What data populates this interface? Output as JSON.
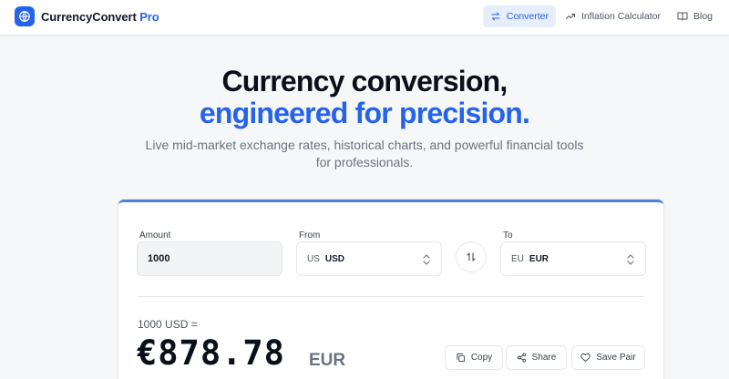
{
  "header": {
    "brand_name": "CurrencyConvert",
    "brand_suffix": "Pro",
    "nav": [
      {
        "label": "Converter",
        "icon": "swap-icon",
        "active": true
      },
      {
        "label": "Inflation Calculator",
        "icon": "trending-up-icon",
        "active": false
      },
      {
        "label": "Blog",
        "icon": "book-icon",
        "active": false
      }
    ]
  },
  "hero": {
    "title": "Currency conversion,",
    "title_accent": "engineered for precision.",
    "subtitle": "Live mid-market exchange rates, historical charts, and powerful financial tools for professionals."
  },
  "converter": {
    "amount_label": "Amount",
    "amount_value": "1000",
    "from_label": "From",
    "from_flag": "US",
    "from_code": "USD",
    "to_label": "To",
    "to_flag": "EU",
    "to_code": "EUR",
    "result_label": "1000 USD =",
    "result_value": "€878.78",
    "result_code": "EUR",
    "actions": {
      "copy": "Copy",
      "share": "Share",
      "save": "Save Pair"
    }
  },
  "colors": {
    "accent": "#2563eb",
    "background": "#f6f7f9",
    "card": "#ffffff"
  }
}
